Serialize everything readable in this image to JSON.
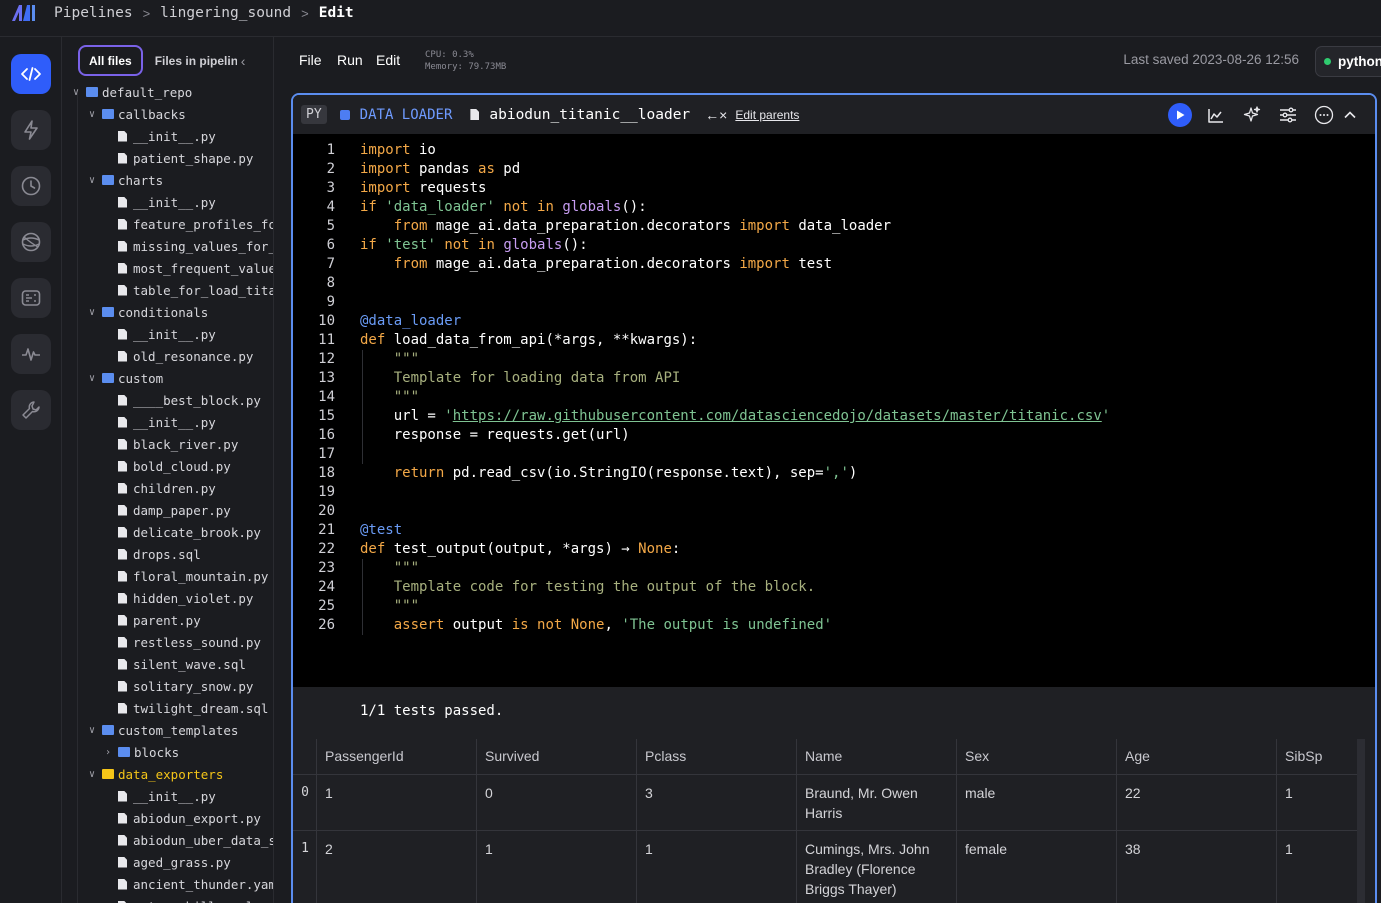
{
  "breadcrumb": {
    "root": "Pipelines",
    "pipeline": "lingering_sound",
    "current": "Edit"
  },
  "file_tabs": {
    "all_files": "All files",
    "files_in_pipeline": "Files in pipeline"
  },
  "tree": [
    {
      "label": "default_repo",
      "kind": "folder",
      "depth": 0,
      "open": true
    },
    {
      "label": "callbacks",
      "kind": "folder",
      "depth": 1,
      "open": true
    },
    {
      "label": "__init__.py",
      "kind": "file",
      "depth": 2
    },
    {
      "label": "patient_shape.py",
      "kind": "file",
      "depth": 2
    },
    {
      "label": "charts",
      "kind": "folder",
      "depth": 1,
      "open": true
    },
    {
      "label": "__init__.py",
      "kind": "file",
      "depth": 2
    },
    {
      "label": "feature_profiles_fo",
      "kind": "file",
      "depth": 2
    },
    {
      "label": "missing_values_for_",
      "kind": "file",
      "depth": 2
    },
    {
      "label": "most_frequent_value",
      "kind": "file",
      "depth": 2
    },
    {
      "label": "table_for_load_tita",
      "kind": "file",
      "depth": 2
    },
    {
      "label": "conditionals",
      "kind": "folder",
      "depth": 1,
      "open": true
    },
    {
      "label": "__init__.py",
      "kind": "file",
      "depth": 2
    },
    {
      "label": "old_resonance.py",
      "kind": "file",
      "depth": 2
    },
    {
      "label": "custom",
      "kind": "folder",
      "depth": 1,
      "open": true
    },
    {
      "label": "____best_block.py",
      "kind": "file",
      "depth": 2
    },
    {
      "label": "__init__.py",
      "kind": "file",
      "depth": 2
    },
    {
      "label": "black_river.py",
      "kind": "file",
      "depth": 2
    },
    {
      "label": "bold_cloud.py",
      "kind": "file",
      "depth": 2
    },
    {
      "label": "children.py",
      "kind": "file",
      "depth": 2
    },
    {
      "label": "damp_paper.py",
      "kind": "file",
      "depth": 2
    },
    {
      "label": "delicate_brook.py",
      "kind": "file",
      "depth": 2
    },
    {
      "label": "drops.sql",
      "kind": "file",
      "depth": 2
    },
    {
      "label": "floral_mountain.py",
      "kind": "file",
      "depth": 2
    },
    {
      "label": "hidden_violet.py",
      "kind": "file",
      "depth": 2
    },
    {
      "label": "parent.py",
      "kind": "file",
      "depth": 2
    },
    {
      "label": "restless_sound.py",
      "kind": "file",
      "depth": 2
    },
    {
      "label": "silent_wave.sql",
      "kind": "file",
      "depth": 2
    },
    {
      "label": "solitary_snow.py",
      "kind": "file",
      "depth": 2
    },
    {
      "label": "twilight_dream.sql",
      "kind": "file",
      "depth": 2
    },
    {
      "label": "custom_templates",
      "kind": "folder",
      "depth": 1,
      "open": true
    },
    {
      "label": "blocks",
      "kind": "folder",
      "depth": 2,
      "open": false
    },
    {
      "label": "data_exporters",
      "kind": "folder-yellow",
      "depth": 1,
      "open": true
    },
    {
      "label": "__init__.py",
      "kind": "file",
      "depth": 2
    },
    {
      "label": "abiodun_export.py",
      "kind": "file",
      "depth": 2
    },
    {
      "label": "abiodun_uber_data_s",
      "kind": "file",
      "depth": 2
    },
    {
      "label": "aged_grass.py",
      "kind": "file",
      "depth": 2
    },
    {
      "label": "ancient_thunder.yam",
      "kind": "file",
      "depth": 2
    },
    {
      "label": "autumn_hill.yaml",
      "kind": "file",
      "depth": 2
    }
  ],
  "menu": {
    "file": "File",
    "run": "Run",
    "edit": "Edit"
  },
  "stats": {
    "cpu": "CPU: 0.3%",
    "memory": "Memory: 79.73MB"
  },
  "saved": "Last saved 2023-08-26 12:56",
  "kernel": {
    "name": "python",
    "status_color": "#2fcb6f"
  },
  "block": {
    "lang": "PY",
    "type": "DATA LOADER",
    "name": "abiodun_titanic__loader",
    "edit_parents": "Edit parents",
    "accent_color": "#5b8def"
  },
  "test_result": "1/1 tests passed.",
  "table": {
    "columns": [
      "PassengerId",
      "Survived",
      "Pclass",
      "Name",
      "Sex",
      "Age",
      "SibSp"
    ],
    "rows": [
      {
        "index": "0",
        "cells": [
          "1",
          "0",
          "3",
          "Braund, Mr. Owen Harris",
          "male",
          "22",
          "1"
        ]
      },
      {
        "index": "1",
        "cells": [
          "2",
          "1",
          "1",
          "Cumings, Mrs. John Bradley (Florence Briggs Thayer)",
          "female",
          "38",
          "1"
        ]
      }
    ]
  },
  "icons": [
    "code-icon",
    "lightning-icon",
    "clock-icon",
    "globe-icon",
    "terminal-icon",
    "pulse-icon",
    "wrench-icon",
    "play-icon",
    "chart-icon",
    "sparkle-icon",
    "sliders-icon",
    "more-icon",
    "chevron-up-icon"
  ]
}
